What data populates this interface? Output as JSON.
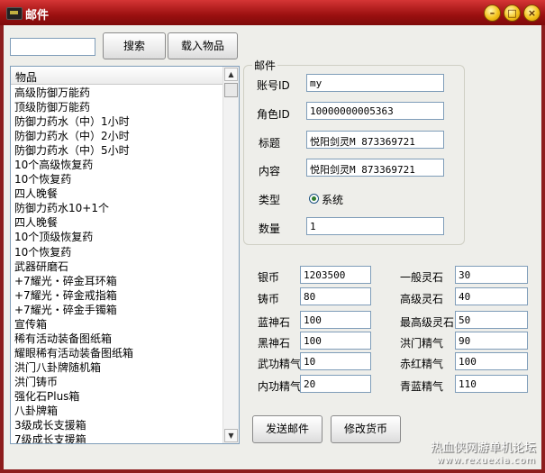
{
  "window": {
    "title": "邮件"
  },
  "toolbar": {
    "search_value": "",
    "search_label": "搜索",
    "load_items_label": "载入物品"
  },
  "item_list": {
    "header": "物品",
    "items": [
      "高级防御万能药",
      "顶级防御万能药",
      "防御力药水（中）1小时",
      "防御力药水（中）2小时",
      "防御力药水（中）5小时",
      "10个高级恢复药",
      "10个恢复药",
      "四人晚餐",
      "防御力药水10+1个",
      "四人晚餐",
      "10个顶级恢复药",
      "10个恢复药",
      "武器研磨石",
      "+7耀光・碎金耳环箱",
      "+7耀光・碎金戒指箱",
      "+7耀光・碎金手镯箱",
      "宣传箱",
      "稀有活动装备图纸箱",
      "耀眼稀有活动装备图纸箱",
      "洪门八卦牌随机箱",
      "洪门铸币",
      "强化石Plus箱",
      "八卦牌箱",
      "3级成长支援箱",
      "7级成长支援箱"
    ]
  },
  "mail": {
    "group_title": "邮件",
    "account_id_label": "账号ID",
    "account_id_value": "my",
    "role_id_label": "角色ID",
    "role_id_value": "10000000005363",
    "subject_label": "标题",
    "subject_value": "悦阳剑灵M 873369721",
    "content_label": "内容",
    "content_value": "悦阳剑灵M 873369721",
    "type_label": "类型",
    "type_option": "系统",
    "quantity_label": "数量",
    "quantity_value": "1"
  },
  "currency": {
    "left": [
      {
        "label": "银币",
        "value": "1203500"
      },
      {
        "label": "铸币",
        "value": "80"
      },
      {
        "label": "蓝神石",
        "value": "100"
      },
      {
        "label": "黑神石",
        "value": "100"
      },
      {
        "label": "武功精气",
        "value": "10"
      },
      {
        "label": "内功精气",
        "value": "20"
      }
    ],
    "right": [
      {
        "label": "一般灵石",
        "value": "30"
      },
      {
        "label": "高级灵石",
        "value": "40"
      },
      {
        "label": "最高级灵石",
        "value": "50"
      },
      {
        "label": "洪门精气",
        "value": "90"
      },
      {
        "label": "赤红精气",
        "value": "100"
      },
      {
        "label": "青蓝精气",
        "value": "110"
      }
    ]
  },
  "actions": {
    "send_mail_label": "发送邮件",
    "modify_currency_label": "修改货币"
  },
  "watermark": {
    "line1": "热血侠网游单机论坛",
    "line2": "www.rexuexia.com"
  },
  "colors": {
    "titlebar": "#b31a1a",
    "frame": "#8d1d1d",
    "client_bg": "#eeeeea",
    "radio_dot": "#2f7d2f"
  },
  "icons": {
    "minimize": "minimize-icon",
    "maximize": "maximize-icon",
    "close": "close-icon"
  }
}
